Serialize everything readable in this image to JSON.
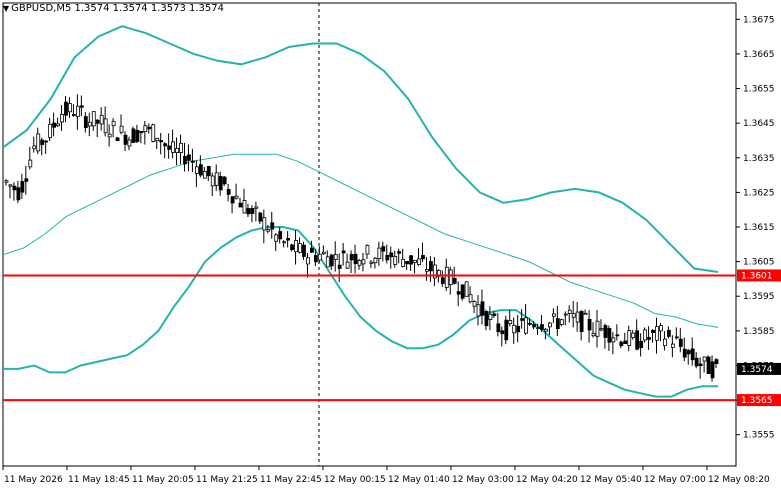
{
  "header": {
    "arrow_icon": "triangle-down-icon",
    "symbol_line": "GBPUSD,M5  1.3574 1.3574 1.3573 1.3574"
  },
  "colors": {
    "background": "#ffffff",
    "candle": "#000000",
    "bands": "#26b3ad",
    "level_line": "#ff0000",
    "grid": "#c0c0c0"
  },
  "chart_data": {
    "type": "line",
    "symbol": "GBPUSD",
    "timeframe": "M5",
    "ohlc_header": [
      "1.3574",
      "1.3574",
      "1.3573",
      "1.3574"
    ],
    "y_axis": {
      "range": [
        1.355,
        1.368
      ],
      "tick_labels": [
        "1.3675",
        "1.3665",
        "1.3655",
        "1.3645",
        "1.3635",
        "1.3625",
        "1.3615",
        "1.3605",
        "1.3595",
        "1.3585",
        "1.3575",
        "1.3565",
        "1.3555"
      ]
    },
    "x_axis": {
      "tick_labels": [
        "11 May 2026",
        "11 May 18:45",
        "11 May 20:05",
        "11 May 21:25",
        "11 May 22:45",
        "12 May 00:15",
        "12 May 01:40",
        "12 May 03:00",
        "12 May 04:20",
        "12 May 05:40",
        "12 May 07:00",
        "12 May 08:20"
      ]
    },
    "horizontal_levels": [
      {
        "label": "1.3601",
        "value": 1.3601
      },
      {
        "label": "1.3565",
        "value": 1.3565
      }
    ],
    "current_price": {
      "label": "1.3574",
      "value": 1.3574
    },
    "series": [
      {
        "values": [
          1.3574,
          1.3574,
          1.3575,
          1.3573,
          1.3573,
          1.3575,
          1.3576,
          1.3577,
          1.3578,
          1.3581,
          1.3585,
          1.3592,
          1.3598,
          1.3605,
          1.3609,
          1.3612,
          1.3614,
          1.3615,
          1.3615,
          1.3614,
          1.3609,
          1.3602,
          1.3595,
          1.3589,
          1.3585,
          1.3582,
          1.358,
          1.358,
          1.3581,
          1.3584,
          1.3588,
          1.359,
          1.3591,
          1.3591,
          1.3588,
          1.3584,
          1.358,
          1.3576,
          1.3572,
          1.357,
          1.3568,
          1.3567,
          1.3566,
          1.3566,
          1.3568,
          1.3569,
          1.3569
        ]
      },
      {
        "values": [
          1.3607,
          1.3609,
          1.3613,
          1.3618,
          1.3621,
          1.3624,
          1.3627,
          1.363,
          1.3632,
          1.3634,
          1.3635,
          1.3636,
          1.3636,
          1.3636,
          1.3634,
          1.3631,
          1.3628,
          1.3625,
          1.3622,
          1.3619,
          1.3616,
          1.3613,
          1.3611,
          1.3609,
          1.3607,
          1.3605,
          1.3602,
          1.3599,
          1.3597,
          1.3595,
          1.3593,
          1.359,
          1.3589,
          1.3587,
          1.3586
        ]
      },
      {
        "values": [
          1.3638,
          1.3643,
          1.3652,
          1.3664,
          1.367,
          1.3673,
          1.3671,
          1.3668,
          1.3665,
          1.3663,
          1.3662,
          1.3664,
          1.3667,
          1.3668,
          1.3668,
          1.3665,
          1.366,
          1.3652,
          1.3641,
          1.3632,
          1.3625,
          1.3622,
          1.3623,
          1.3625,
          1.3626,
          1.3625,
          1.3622,
          1.3617,
          1.361,
          1.3603,
          1.3602
        ]
      },
      {
        "values": [
          1.3628,
          1.3625,
          1.3638,
          1.3641,
          1.3648,
          1.3649,
          1.3646,
          1.3645,
          1.3643,
          1.3641,
          1.3643,
          1.3642,
          1.3637,
          1.3636,
          1.3633,
          1.3629,
          1.3627,
          1.3623,
          1.3619,
          1.3616,
          1.3611,
          1.3609,
          1.3607,
          1.3607,
          1.3606,
          1.3606,
          1.3607,
          1.3607,
          1.3607,
          1.3606,
          1.3605,
          1.3603,
          1.3601,
          1.3599,
          1.3595,
          1.359,
          1.3586,
          1.3585,
          1.3587,
          1.3588,
          1.3587,
          1.3589,
          1.3588,
          1.3586,
          1.3585,
          1.3583,
          1.3582,
          1.3583,
          1.3584,
          1.3582,
          1.3578,
          1.3575,
          1.3574
        ]
      }
    ]
  }
}
